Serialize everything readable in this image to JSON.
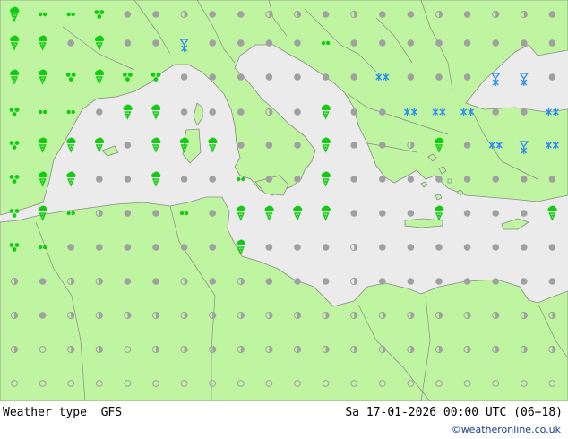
{
  "footer": {
    "title": "Weather type  GFS",
    "date": "Sa 17-01-2026 00:00 UTC (06+18)",
    "credit": "©weatheronline.co.uk"
  },
  "colors": {
    "land": "#bff5a0",
    "sea": "#ebebeb",
    "border": "#8a8a8a",
    "rain": "#11cc11",
    "snow": "#2a8cf0",
    "symbol_grey": "#a0a0a0"
  },
  "icons": [
    "rain-shower-icon",
    "rain-icon",
    "drizzle-icon",
    "snow-icon",
    "overcast-icon",
    "cloudy-icon",
    "clear-icon"
  ]
}
